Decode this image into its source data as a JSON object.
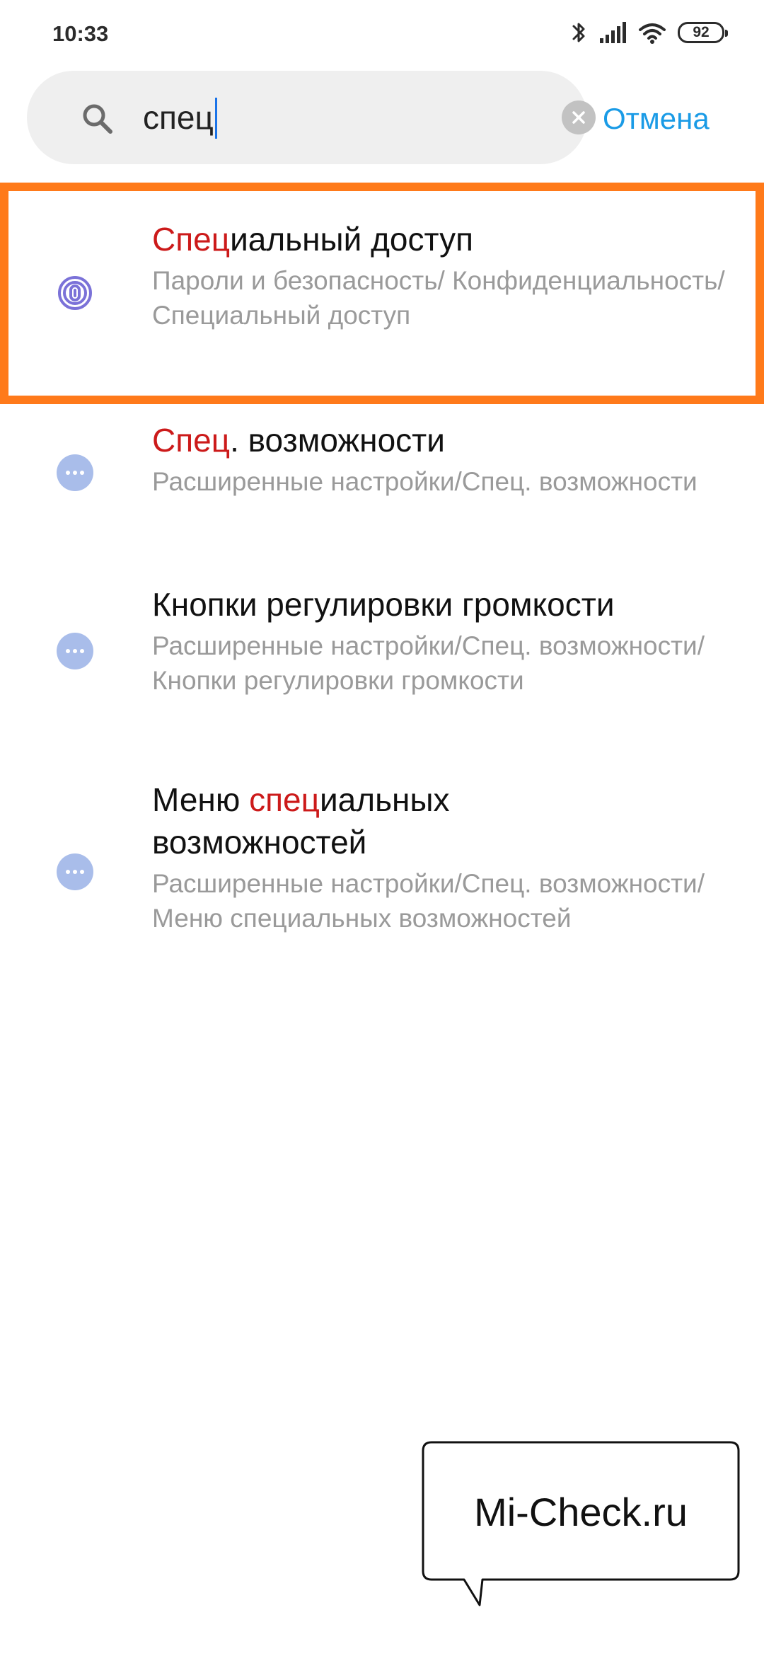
{
  "status_bar": {
    "time": "10:33",
    "battery": "92",
    "icons": [
      "bluetooth-icon",
      "signal-icon",
      "wifi-icon",
      "battery-icon"
    ]
  },
  "search": {
    "query": "спец",
    "cancel_label": "Отмена",
    "icon": "search-icon",
    "clear_icon": "clear-icon"
  },
  "results": [
    {
      "title_before": "",
      "title_match": "Спец",
      "title_after": "иальный доступ",
      "path": "Пароли и безопасность/ Конфиденциальность/Специальный доступ",
      "icon": "fingerprint-icon",
      "highlighted": true
    },
    {
      "title_before": "",
      "title_match": "Спец",
      "title_after": ". возможности",
      "path": "Расширенные настройки/Спец. возможности",
      "icon": "more-dots-icon",
      "highlighted": false
    },
    {
      "title_before": "Кнопки регулировки громкости",
      "title_match": "",
      "title_after": "",
      "path": "Расширенные настройки/Спец. возможности/Кнопки регулировки громкости",
      "icon": "more-dots-icon",
      "highlighted": false
    },
    {
      "title_before": "Меню ",
      "title_match": "спец",
      "title_after": "иальных возможностей",
      "path": "Расширенные настройки/Спец. возможности/Меню специальных возможностей",
      "icon": "more-dots-icon",
      "highlighted": false
    }
  ],
  "watermark": {
    "text": "Mi-Check.ru"
  },
  "colors": {
    "accent": "#1a9be6",
    "match_highlight": "#cc1a1a",
    "frame": "#ff7a1a",
    "icon_fingerprint": "#7b72d8",
    "icon_dots": "#a9bdea"
  }
}
